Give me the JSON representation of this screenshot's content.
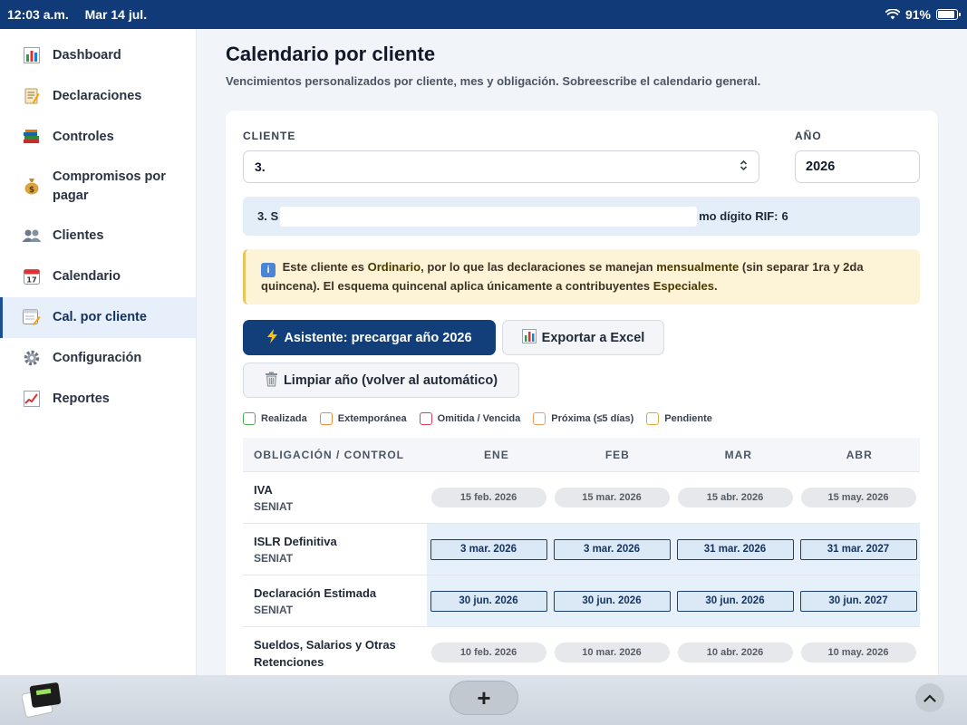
{
  "status_bar": {
    "time": "12:03 a.m.",
    "date": "Mar 14 jul.",
    "battery": "91%",
    "battery_level": 0.91
  },
  "sidebar": {
    "items": [
      {
        "label": "Dashboard",
        "icon": "chart-bars-icon"
      },
      {
        "label": "Declaraciones",
        "icon": "memo-icon"
      },
      {
        "label": "Controles",
        "icon": "books-icon"
      },
      {
        "label": "Compromisos por pagar",
        "icon": "money-bag-icon"
      },
      {
        "label": "Clientes",
        "icon": "users-icon"
      },
      {
        "label": "Calendario",
        "icon": "calendar-icon"
      },
      {
        "label": "Cal. por cliente",
        "icon": "calendar-edit-icon",
        "active": true
      },
      {
        "label": "Configuración",
        "icon": "gear-icon"
      },
      {
        "label": "Reportes",
        "icon": "trend-chart-icon"
      }
    ]
  },
  "main": {
    "title": "Calendario por cliente",
    "subtitle": "Vencimientos personalizados por cliente, mes y obligación. Sobreescribe el calendario general.",
    "client_label": "CLIENTE",
    "client_value": "3.",
    "year_label": "AÑO",
    "year_value": "2026",
    "info_prefix": "3. S",
    "info_suffix": "mo dígito RIF:",
    "info_digit": "6",
    "notice": {
      "p1": "Este cliente es",
      "b1": "Ordinario",
      "p2": ", por lo que las declaraciones se manejan",
      "b2": "mensualmente",
      "p3": "(sin separar 1ra y 2da quincena). El esquema quincenal aplica únicamente a contribuyentes",
      "b3": "Especiales",
      "p4": "."
    },
    "buttons": {
      "wizard": "Asistente: precargar año 2026",
      "export": "Exportar a Excel",
      "clear": "Limpiar año (volver al automático)"
    },
    "legend": [
      {
        "label": "Realizada",
        "color": "#4caf50"
      },
      {
        "label": "Extemporánea",
        "color": "#f08c3c"
      },
      {
        "label": "Omitida / Vencida",
        "color": "#d9405a"
      },
      {
        "label": "Próxima (≤5 días)",
        "color": "#ef9b5c"
      },
      {
        "label": "Pendiente",
        "color": "#d8aa42"
      }
    ],
    "table": {
      "header_first": "OBLIGACIÓN / CONTROL",
      "months": [
        "ENE",
        "FEB",
        "MAR",
        "ABR"
      ],
      "rows": [
        {
          "name": "IVA",
          "org": "SENIAT",
          "style": "pill",
          "dates": [
            "15 feb. 2026",
            "15 mar. 2026",
            "15 abr. 2026",
            "15 may. 2026"
          ]
        },
        {
          "name": "ISLR Definitiva",
          "org": "SENIAT",
          "style": "box",
          "dates": [
            "3 mar. 2026",
            "3 mar. 2026",
            "31 mar. 2026",
            "31 mar. 2027"
          ]
        },
        {
          "name": "Declaración Estimada",
          "org": "SENIAT",
          "style": "box",
          "dates": [
            "30 jun. 2026",
            "30 jun. 2026",
            "30 jun. 2026",
            "30 jun. 2027"
          ]
        },
        {
          "name": "Sueldos, Salarios y Otras Retenciones",
          "org": "",
          "style": "pill",
          "dates": [
            "10 feb. 2026",
            "10 mar. 2026",
            "10 abr. 2026",
            "10 may. 2026"
          ]
        }
      ]
    }
  },
  "dock": {
    "plus": "+",
    "up": "⌃"
  }
}
